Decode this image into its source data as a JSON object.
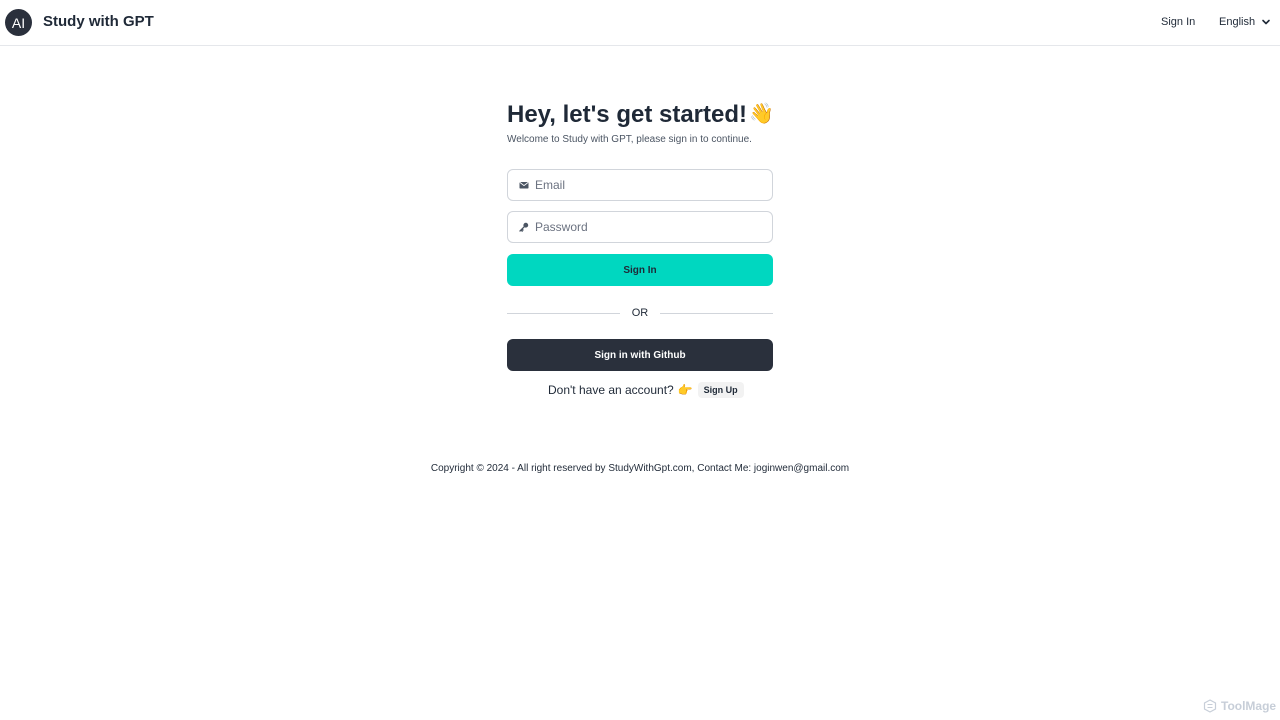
{
  "navbar": {
    "logo_text": "AI",
    "brand": "Study with GPT",
    "sign_in_label": "Sign In",
    "language": "English"
  },
  "main": {
    "heading": "Hey, let's get started!",
    "heading_emoji": "👋",
    "subtitle": "Welcome to Study with GPT, please sign in to continue.",
    "email_placeholder": "Email",
    "password_placeholder": "Password",
    "sign_in_button": "Sign In",
    "divider_text": "OR",
    "github_button": "Sign in with Github",
    "no_account_text": "Don't have an account?",
    "pointer_emoji": "👉",
    "sign_up_label": "Sign Up"
  },
  "footer": {
    "copyright": "Copyright © 2024 - All right reserved by StudyWithGpt.com, Contact Me: joginwen@gmail.com"
  },
  "watermark": {
    "text": "ToolMage"
  },
  "colors": {
    "accent": "#00d7c0",
    "dark": "#2a303c"
  }
}
